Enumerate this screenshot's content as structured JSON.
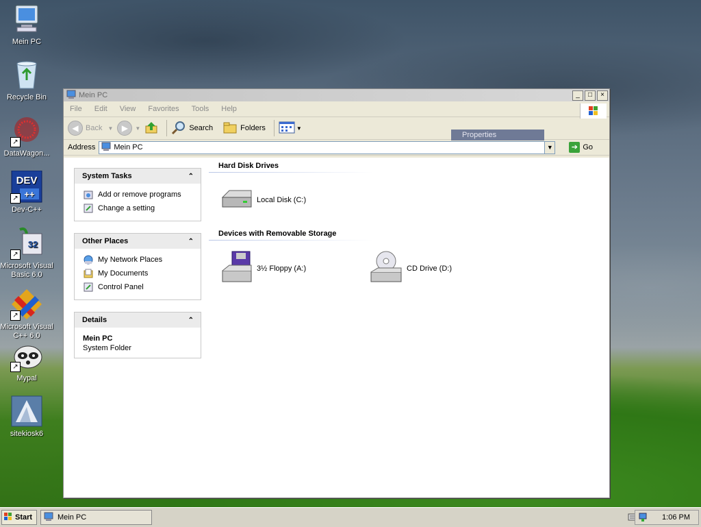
{
  "desktop": {
    "icons": [
      {
        "label": "Mein PC",
        "icon": "computer-icon"
      },
      {
        "label": "Recycle Bin",
        "icon": "recycle-bin-icon"
      },
      {
        "label": "DataWagon...",
        "icon": "datawagon-icon"
      },
      {
        "label": "Dev-C++",
        "icon": "devcpp-icon",
        "badge": "DEV"
      },
      {
        "label": "Microsoft Visual Basic 6.0",
        "icon": "vb6-icon",
        "badge": "32"
      },
      {
        "label": "Microsoft Visual C++ 6.0",
        "icon": "vc6-icon"
      },
      {
        "label": "Mypal",
        "icon": "mypal-icon"
      },
      {
        "label": "sitekiosk6",
        "icon": "sitekiosk-icon"
      }
    ]
  },
  "window": {
    "title": "Mein PC",
    "controls": {
      "minimize": "_",
      "maximize": "□",
      "close": "×"
    },
    "menu": [
      "File",
      "Edit",
      "View",
      "Favorites",
      "Tools",
      "Help"
    ],
    "toolbar": {
      "back": "Back",
      "search": "Search",
      "folders": "Folders"
    },
    "tooltip": "Properties",
    "address": {
      "label": "Address",
      "value": "Mein PC",
      "go": "Go"
    },
    "sidebar": {
      "system_tasks": {
        "title": "System Tasks",
        "items": [
          "Add or remove programs",
          "Change a setting"
        ]
      },
      "other_places": {
        "title": "Other Places",
        "items": [
          "My Network Places",
          "My Documents",
          "Control Panel"
        ]
      },
      "details": {
        "title": "Details",
        "name": "Mein PC",
        "type": "System Folder"
      }
    },
    "sections": {
      "hard_disks": {
        "title": "Hard Disk Drives",
        "drives": [
          "Local Disk (C:)"
        ]
      },
      "removable": {
        "title": "Devices with Removable Storage",
        "drives": [
          "3½ Floppy (A:)",
          "CD Drive (D:)"
        ]
      }
    }
  },
  "taskbar": {
    "start": "Start",
    "task": "Mein PC",
    "clock": "1:06 PM"
  },
  "colors": {
    "titlebar_inactive": "#d0d0d0",
    "pane_header": "#ebebeb",
    "tooltip_bg": "#6f7a96",
    "go_green": "#3aa33a"
  }
}
